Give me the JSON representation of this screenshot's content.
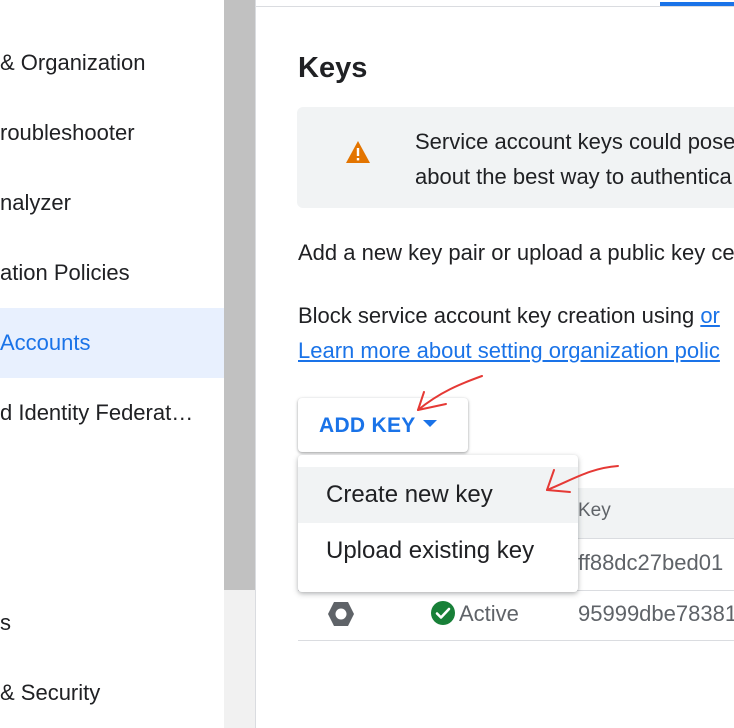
{
  "sidebar": {
    "items": [
      {
        "label": "& Organization"
      },
      {
        "label": "roubleshooter"
      },
      {
        "label": "nalyzer"
      },
      {
        "label": "ation Policies"
      },
      {
        "label": "Accounts"
      },
      {
        "label": "d Identity Federat…"
      },
      {
        "label": "s"
      },
      {
        "label": "& Security"
      }
    ]
  },
  "main": {
    "title": "Keys",
    "warning": {
      "line1": "Service account keys could pose",
      "line2": "about the best way to authentica"
    },
    "intro": "Add a new key pair or upload a public key ce",
    "block_prefix": "Block service account key creation using ",
    "block_link": "or",
    "learn_link": "Learn more about setting organization polic",
    "add_key": {
      "label": "ADD KEY"
    },
    "menu": {
      "items": [
        {
          "label": "Create new key"
        },
        {
          "label": "Upload existing key"
        }
      ]
    },
    "table": {
      "headers": {
        "key": "Key"
      },
      "rows": [
        {
          "key_id": "ff88dc27bed01"
        },
        {
          "status": "Active",
          "key_id": "95999dbe78381"
        }
      ]
    }
  },
  "colors": {
    "accent": "#1a73e8",
    "warning": "#e37400",
    "success": "#188038",
    "annotation": "#e53935"
  }
}
